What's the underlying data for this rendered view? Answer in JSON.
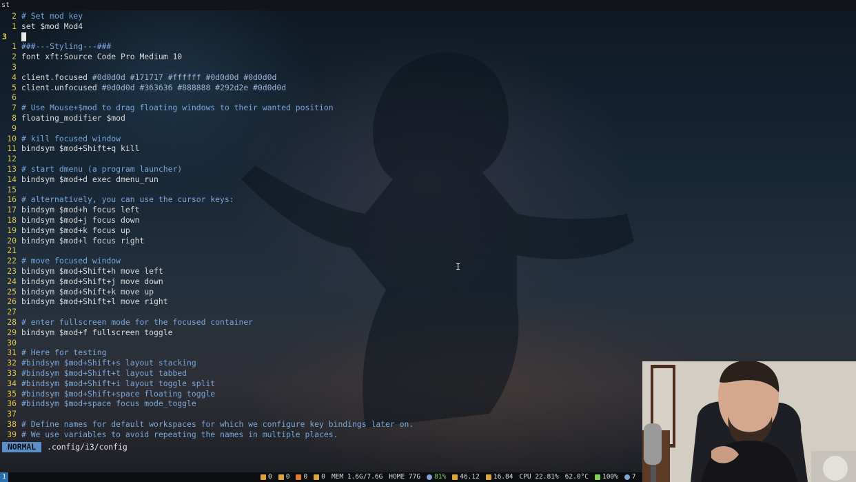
{
  "window": {
    "title": "st"
  },
  "editor": {
    "lines": [
      {
        "num": "2",
        "text": "# Set mod key",
        "comment": true
      },
      {
        "num": "1",
        "text": "set $mod Mod4",
        "comment": false
      },
      {
        "num": "3",
        "text": "",
        "comment": false,
        "current": true
      },
      {
        "num": "1",
        "text": "###---Styling---###",
        "comment": true
      },
      {
        "num": "2",
        "text": "font xft:Source Code Pro Medium 10",
        "comment": false
      },
      {
        "num": "3",
        "text": "",
        "comment": false
      },
      {
        "num": "4",
        "text": "client.focused #0d0d0d #171717 #ffffff #0d0d0d #0d0d0d",
        "comment": false,
        "colors": true
      },
      {
        "num": "5",
        "text": "client.unfocused #0d0d0d #363636 #888888 #292d2e #0d0d0d",
        "comment": false,
        "colors": true
      },
      {
        "num": "6",
        "text": "",
        "comment": false
      },
      {
        "num": "7",
        "text": "# Use Mouse+$mod to drag floating windows to their wanted position",
        "comment": true
      },
      {
        "num": "8",
        "text": "floating_modifier $mod",
        "comment": false
      },
      {
        "num": "9",
        "text": "",
        "comment": false
      },
      {
        "num": "10",
        "text": "# kill focused window",
        "comment": true
      },
      {
        "num": "11",
        "text": "bindsym $mod+Shift+q kill",
        "comment": false
      },
      {
        "num": "12",
        "text": "",
        "comment": false
      },
      {
        "num": "13",
        "text": "# start dmenu (a program launcher)",
        "comment": true
      },
      {
        "num": "14",
        "text": "bindsym $mod+d exec dmenu_run",
        "comment": false
      },
      {
        "num": "15",
        "text": "",
        "comment": false
      },
      {
        "num": "16",
        "text": "# alternatively, you can use the cursor keys:",
        "comment": true
      },
      {
        "num": "17",
        "text": "bindsym $mod+h focus left",
        "comment": false
      },
      {
        "num": "18",
        "text": "bindsym $mod+j focus down",
        "comment": false
      },
      {
        "num": "19",
        "text": "bindsym $mod+k focus up",
        "comment": false
      },
      {
        "num": "20",
        "text": "bindsym $mod+l focus right",
        "comment": false
      },
      {
        "num": "21",
        "text": "",
        "comment": false
      },
      {
        "num": "22",
        "text": "# move focused window",
        "comment": true
      },
      {
        "num": "23",
        "text": "bindsym $mod+Shift+h move left",
        "comment": false
      },
      {
        "num": "24",
        "text": "bindsym $mod+Shift+j move down",
        "comment": false
      },
      {
        "num": "25",
        "text": "bindsym $mod+Shift+k move up",
        "comment": false
      },
      {
        "num": "26",
        "text": "bindsym $mod+Shift+l move right",
        "comment": false
      },
      {
        "num": "27",
        "text": "",
        "comment": false
      },
      {
        "num": "28",
        "text": "# enter fullscreen mode for the focused container",
        "comment": true
      },
      {
        "num": "29",
        "text": "bindsym $mod+f fullscreen toggle",
        "comment": false
      },
      {
        "num": "30",
        "text": "",
        "comment": false
      },
      {
        "num": "31",
        "text": "# Here for testing",
        "comment": true
      },
      {
        "num": "32",
        "text": "#bindsym $mod+Shift+s layout stacking",
        "comment": true
      },
      {
        "num": "33",
        "text": "#bindsym $mod+Shift+t layout tabbed",
        "comment": true
      },
      {
        "num": "34",
        "text": "#bindsym $mod+Shift+i layout toggle split",
        "comment": true
      },
      {
        "num": "35",
        "text": "#bindsym $mod+Shift+space floating toggle",
        "comment": true
      },
      {
        "num": "36",
        "text": "#bindsym $mod+space focus mode_toggle",
        "comment": true
      },
      {
        "num": "37",
        "text": "",
        "comment": false
      },
      {
        "num": "38",
        "text": "# Define names for default workspaces for which we configure key bindings later on.",
        "comment": true
      },
      {
        "num": "39",
        "text": "# We use variables to avoid repeating the names in multiple places.",
        "comment": true
      }
    ]
  },
  "statusline": {
    "mode": "NORMAL",
    "file": ".config/i3/config"
  },
  "i3bar": {
    "workspace": "1",
    "blocks": [
      {
        "icon": "package-icon",
        "color": "#e0a040",
        "value": "0"
      },
      {
        "icon": "download-icon",
        "color": "#d9a441",
        "value": "0"
      },
      {
        "icon": "update-icon",
        "color": "#e07a30",
        "value": "0"
      },
      {
        "icon": "upload-icon",
        "color": "#d9a441",
        "value": "0"
      },
      {
        "icon": "",
        "color": "#dcdcdc",
        "value": "MEM 1.6G/7.6G"
      },
      {
        "icon": "",
        "color": "#dcdcdc",
        "value": "HOME 77G"
      },
      {
        "icon": "wifi-icon",
        "color": "#7fa6d6",
        "value": "81%",
        "green": true
      },
      {
        "icon": "net-down-icon",
        "color": "#d9a441",
        "value": "46.12"
      },
      {
        "icon": "net-up-icon",
        "color": "#d9a441",
        "value": "16.84"
      },
      {
        "icon": "",
        "color": "#dcdcdc",
        "value": "CPU 22.81%"
      },
      {
        "icon": "",
        "color": "#dcdcdc",
        "value": "62.0°C"
      },
      {
        "icon": "battery-icon",
        "color": "#7fd35a",
        "value": "100%"
      },
      {
        "icon": "volume-icon",
        "color": "#7fa6d6",
        "value": "7"
      }
    ]
  }
}
